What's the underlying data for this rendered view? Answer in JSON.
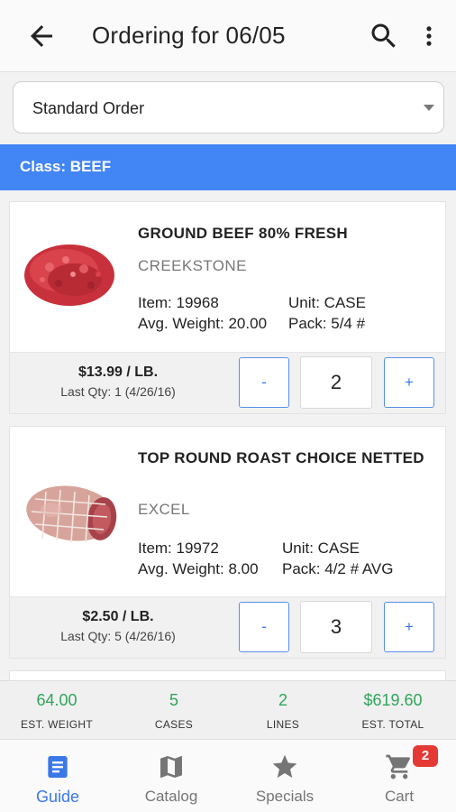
{
  "header": {
    "title": "Ordering for 06/05"
  },
  "order_type": {
    "selected": "Standard Order"
  },
  "class_header": "Class: BEEF",
  "items": [
    {
      "name": "GROUND BEEF 80% FRESH",
      "brand": "CREEKSTONE",
      "item_no": "Item: 19968",
      "avg_weight": "Avg. Weight: 20.00",
      "unit": "Unit: CASE",
      "pack": "Pack: 5/4 #",
      "price": "$13.99 / LB.",
      "last_qty": "Last Qty: 1 (4/26/16)",
      "qty": "2",
      "minus": "-",
      "plus": "+"
    },
    {
      "name": "TOP ROUND ROAST CHOICE NETTED",
      "brand": "EXCEL",
      "item_no": "Item: 19972",
      "avg_weight": "Avg. Weight: 8.00",
      "unit": "Unit: CASE",
      "pack": "Pack: 4/2 # AVG",
      "price": "$2.50 / LB.",
      "last_qty": "Last Qty: 5 (4/26/16)",
      "qty": "3",
      "minus": "-",
      "plus": "+"
    }
  ],
  "summary": [
    {
      "value": "64.00",
      "label": "EST. WEIGHT"
    },
    {
      "value": "5",
      "label": "CASES"
    },
    {
      "value": "2",
      "label": "LINES"
    },
    {
      "value": "$619.60",
      "label": "EST. TOTAL"
    }
  ],
  "nav": [
    {
      "label": "Guide",
      "icon": "guide-icon",
      "active": true
    },
    {
      "label": "Catalog",
      "icon": "map-icon",
      "active": false
    },
    {
      "label": "Specials",
      "icon": "star-icon",
      "active": false
    },
    {
      "label": "Cart",
      "icon": "cart-icon",
      "active": false
    }
  ],
  "cart_badge": "2",
  "colors": {
    "accent": "#4285f4",
    "positive": "#2fa55b",
    "badge": "#e53935"
  }
}
